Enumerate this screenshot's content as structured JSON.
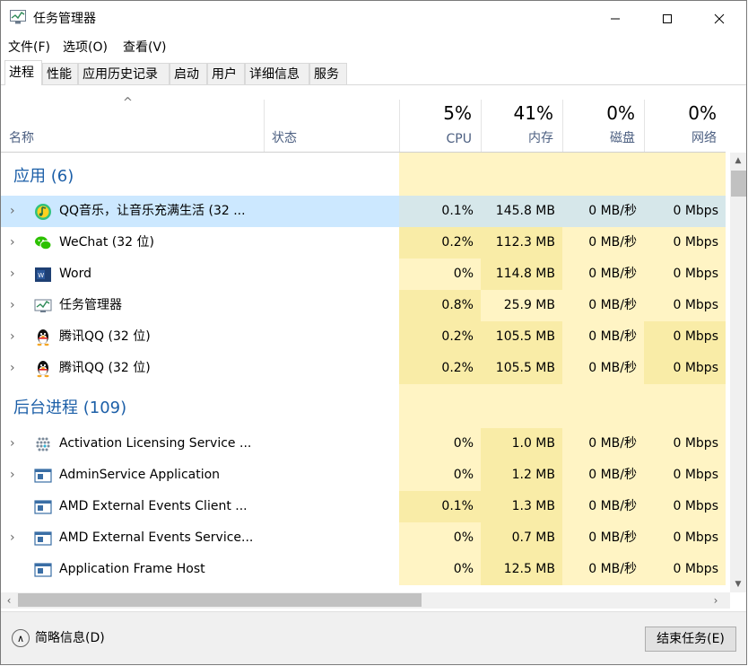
{
  "window": {
    "title": "任务管理器",
    "minimize": "—",
    "maximize": "☐",
    "close": "✕"
  },
  "menu": [
    "文件(F)",
    "选项(O)",
    "查看(V)"
  ],
  "tabs": [
    "进程",
    "性能",
    "应用历史记录",
    "启动",
    "用户",
    "详细信息",
    "服务"
  ],
  "header": {
    "name": "名称",
    "status": "状态",
    "cpu_pct": "5%",
    "cpu": "CPU",
    "mem_pct": "41%",
    "mem": "内存",
    "disk_pct": "0%",
    "disk": "磁盘",
    "net_pct": "0%",
    "net": "网络",
    "sort_arrow": "^"
  },
  "groups": {
    "apps": "应用 (6)",
    "background": "后台进程 (109)"
  },
  "apps": [
    {
      "name": "QQ音乐，让音乐充满生活 (32 ...",
      "icon": "qqmusic-icon",
      "cpu": "0.1%",
      "mem": "145.8 MB",
      "disk": "0 MB/秒",
      "net": "0 Mbps"
    },
    {
      "name": "WeChat (32 位)",
      "icon": "wechat-icon",
      "cpu": "0.2%",
      "mem": "112.3 MB",
      "disk": "0 MB/秒",
      "net": "0 Mbps"
    },
    {
      "name": "Word",
      "icon": "word-icon",
      "cpu": "0%",
      "mem": "114.8 MB",
      "disk": "0 MB/秒",
      "net": "0 Mbps"
    },
    {
      "name": "任务管理器",
      "icon": "task-manager-icon",
      "cpu": "0.8%",
      "mem": "25.9 MB",
      "disk": "0 MB/秒",
      "net": "0 Mbps"
    },
    {
      "name": "腾讯QQ (32 位)",
      "icon": "qq-icon",
      "cpu": "0.2%",
      "mem": "105.5 MB",
      "disk": "0 MB/秒",
      "net": "0 Mbps"
    },
    {
      "name": "腾讯QQ (32 位)",
      "icon": "qq-icon",
      "cpu": "0.2%",
      "mem": "105.5 MB",
      "disk": "0 MB/秒",
      "net": "0 Mbps"
    }
  ],
  "background": [
    {
      "name": "Activation Licensing Service ...",
      "icon": "activation-icon",
      "cpu": "0%",
      "mem": "1.0 MB",
      "disk": "0 MB/秒",
      "net": "0 Mbps"
    },
    {
      "name": "AdminService Application",
      "icon": "service-app-icon",
      "cpu": "0%",
      "mem": "1.2 MB",
      "disk": "0 MB/秒",
      "net": "0 Mbps"
    },
    {
      "name": "AMD External Events Client ...",
      "icon": "service-app-icon",
      "cpu": "0.1%",
      "mem": "1.3 MB",
      "disk": "0 MB/秒",
      "net": "0 Mbps"
    },
    {
      "name": "AMD External Events Service...",
      "icon": "service-app-icon",
      "cpu": "0%",
      "mem": "0.7 MB",
      "disk": "0 MB/秒",
      "net": "0 Mbps"
    },
    {
      "name": "Application Frame Host",
      "icon": "service-app-icon",
      "cpu": "0%",
      "mem": "12.5 MB",
      "disk": "0 MB/秒",
      "net": "0 Mbps"
    }
  ],
  "footer": {
    "fewer_details": "简略信息(D)",
    "end_task": "结束任务(E)"
  }
}
